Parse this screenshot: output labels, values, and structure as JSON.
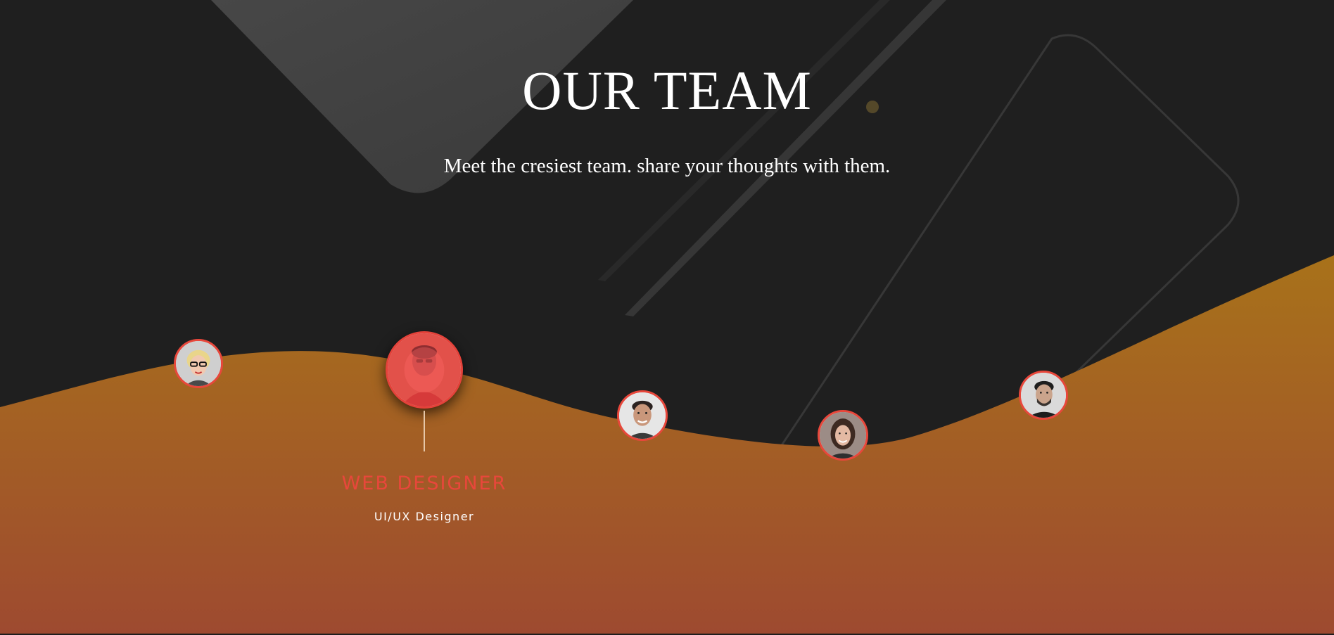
{
  "section": {
    "title": "OUR TEAM",
    "subtitle": "Meet the cresiest team. share your thoughts with them."
  },
  "colors": {
    "background": "#1f1f1f",
    "wave_top": "#a8721a",
    "wave_bottom": "#9e4a30",
    "accent": "#e8473b"
  },
  "team": {
    "members": [
      {
        "name": "member-1",
        "avatar": "woman-glasses-portrait"
      },
      {
        "name": "member-2",
        "avatar": "man-portrait-red-tint",
        "active": true
      },
      {
        "name": "member-3",
        "avatar": "man-smiling-portrait"
      },
      {
        "name": "member-4",
        "avatar": "woman-smiling-portrait"
      },
      {
        "name": "member-5",
        "avatar": "man-beard-portrait"
      }
    ],
    "selected": {
      "role": "WEB DESIGNER",
      "subrole": "UI/UX Designer"
    }
  }
}
